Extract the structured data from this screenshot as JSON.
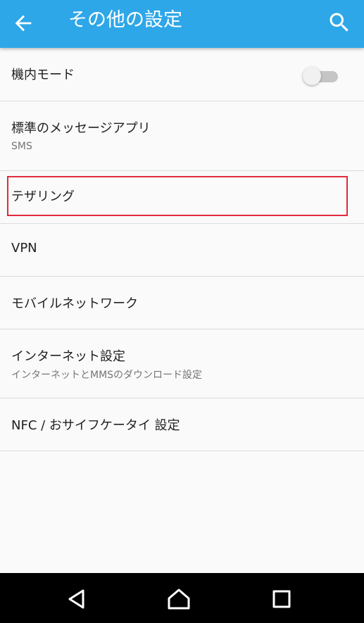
{
  "appbar": {
    "title": "その他の設定",
    "back_icon": "arrow-left-icon",
    "search_icon": "search-icon",
    "color": "#2ea7e8"
  },
  "settings": {
    "airplane": {
      "label": "機内モード",
      "enabled": false
    },
    "sms_app": {
      "label": "標準のメッセージアプリ",
      "summary": "SMS"
    },
    "tethering": {
      "label": "テザリング"
    },
    "vpn": {
      "label": "VPN"
    },
    "mobile_network": {
      "label": "モバイルネットワーク"
    },
    "internet_settings": {
      "label": "インターネット設定",
      "summary": "インターネットとMMSのダウンロード設定"
    },
    "nfc": {
      "label": "NFC / おサイフケータイ 設定"
    }
  },
  "highlight_color": "#e02b3a",
  "navbar": {
    "back_icon": "triangle-back-icon",
    "home_icon": "home-icon",
    "recents_icon": "square-recents-icon"
  }
}
